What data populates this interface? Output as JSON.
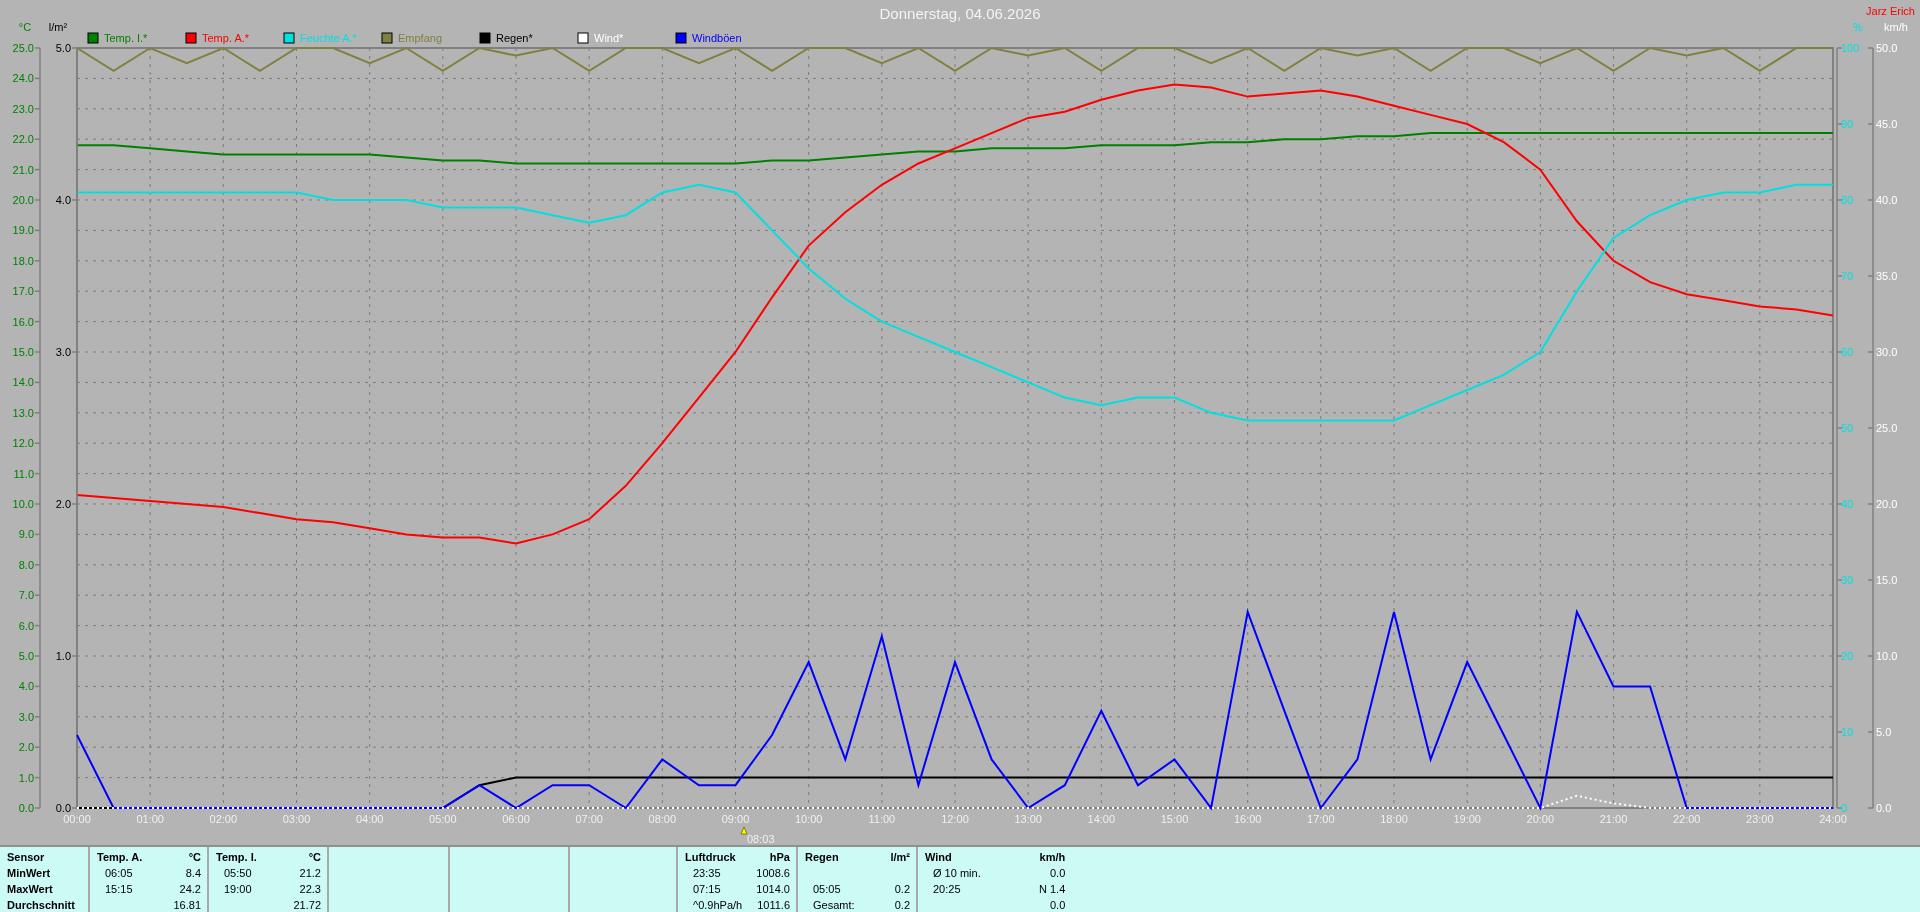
{
  "title": "Donnerstag, 04.06.2026",
  "author": "Jarz Erich",
  "plot": {
    "layers": [
      {
        "chart_data": {
          "type": "line",
          "ylabel": "°C",
          "xlim": [
            0,
            24
          ],
          "ylim": [
            0,
            25
          ],
          "grid": true,
          "legend": "top",
          "x": [
            0,
            0.5,
            1,
            1.5,
            2,
            2.5,
            3,
            3.5,
            4,
            4.5,
            5,
            5.5,
            6,
            6.5,
            7,
            7.5,
            8,
            8.5,
            9,
            9.5,
            10,
            10.5,
            11,
            11.5,
            12,
            12.5,
            13,
            13.5,
            14,
            14.5,
            15,
            15.5,
            16,
            16.5,
            17,
            17.5,
            18,
            18.5,
            19,
            19.5,
            20,
            20.5,
            21,
            21.5,
            22,
            22.5,
            23,
            23.5,
            24
          ],
          "xticks": [
            {
              "value": 0,
              "label": "00:00"
            },
            {
              "value": 1,
              "label": "01:00"
            },
            {
              "value": 2,
              "label": "02:00"
            },
            {
              "value": 3,
              "label": "03:00"
            },
            {
              "value": 4,
              "label": "04:00"
            },
            {
              "value": 5,
              "label": "05:00"
            },
            {
              "value": 6,
              "label": "06:00"
            },
            {
              "value": 7,
              "label": "07:00"
            },
            {
              "value": 8,
              "label": "08:00"
            },
            {
              "value": 9,
              "label": "09:00"
            },
            {
              "value": 10,
              "label": "10:00"
            },
            {
              "value": 11,
              "label": "11:00"
            },
            {
              "value": 12,
              "label": "12:00"
            },
            {
              "value": 13,
              "label": "13:00"
            },
            {
              "value": 14,
              "label": "14:00"
            },
            {
              "value": 15,
              "label": "15:00"
            },
            {
              "value": 16,
              "label": "16:00"
            },
            {
              "value": 17,
              "label": "17:00"
            },
            {
              "value": 18,
              "label": "18:00"
            },
            {
              "value": 19,
              "label": "19:00"
            },
            {
              "value": 20,
              "label": "20:00"
            },
            {
              "value": 21,
              "label": "21:00"
            },
            {
              "value": 22,
              "label": "22:00"
            },
            {
              "value": 23,
              "label": "23:00"
            },
            {
              "value": 24,
              "label": "24:00"
            }
          ],
          "yticks": [
            {
              "value": 0,
              "label": "0.0"
            },
            {
              "value": 1,
              "label": "1.0"
            },
            {
              "value": 2,
              "label": "2.0"
            },
            {
              "value": 3,
              "label": "3.0"
            },
            {
              "value": 4,
              "label": "4.0"
            },
            {
              "value": 5,
              "label": "5.0"
            },
            {
              "value": 6,
              "label": "6.0"
            },
            {
              "value": 7,
              "label": "7.0"
            },
            {
              "value": 8,
              "label": "8.0"
            },
            {
              "value": 9,
              "label": "9.0"
            },
            {
              "value": 10,
              "label": "10.0"
            },
            {
              "value": 11,
              "label": "11.0"
            },
            {
              "value": 12,
              "label": "12.0"
            },
            {
              "value": 13,
              "label": "13.0"
            },
            {
              "value": 14,
              "label": "14.0"
            },
            {
              "value": 15,
              "label": "15.0"
            },
            {
              "value": 16,
              "label": "16.0"
            },
            {
              "value": 17,
              "label": "17.0"
            },
            {
              "value": 18,
              "label": "18.0"
            },
            {
              "value": 19,
              "label": "19.0"
            },
            {
              "value": 20,
              "label": "20.0"
            },
            {
              "value": 21,
              "label": "21.0"
            },
            {
              "value": 22,
              "label": "22.0"
            },
            {
              "value": 23,
              "label": "23.0"
            },
            {
              "value": 24,
              "label": "24.0"
            },
            {
              "value": 25,
              "label": "25.0"
            }
          ],
          "series": [
            {
              "name": "Temp. I.*",
              "color": "#008000",
              "values": [
                21.8,
                21.8,
                21.7,
                21.6,
                21.5,
                21.5,
                21.5,
                21.5,
                21.5,
                21.4,
                21.3,
                21.3,
                21.2,
                21.2,
                21.2,
                21.2,
                21.2,
                21.2,
                21.2,
                21.3,
                21.3,
                21.4,
                21.5,
                21.6,
                21.6,
                21.7,
                21.7,
                21.7,
                21.8,
                21.8,
                21.8,
                21.9,
                21.9,
                22.0,
                22.0,
                22.1,
                22.1,
                22.2,
                22.2,
                22.2,
                22.2,
                22.2,
                22.2,
                22.2,
                22.2,
                22.2,
                22.2,
                22.2,
                22.2
              ]
            },
            {
              "name": "Temp. A.*",
              "color": "#ff0000",
              "values": [
                10.3,
                10.2,
                10.1,
                10.0,
                9.9,
                9.7,
                9.5,
                9.4,
                9.2,
                9.0,
                8.9,
                8.9,
                8.7,
                9.0,
                9.5,
                10.6,
                12.0,
                13.5,
                15.0,
                16.8,
                18.5,
                19.6,
                20.5,
                21.2,
                21.7,
                22.2,
                22.7,
                22.9,
                23.3,
                23.6,
                23.8,
                23.7,
                23.4,
                23.5,
                23.6,
                23.4,
                23.1,
                22.8,
                22.5,
                21.9,
                21.0,
                19.3,
                18.0,
                17.3,
                16.9,
                16.7,
                16.5,
                16.4,
                16.2
              ]
            }
          ],
          "annotations": [
            "08:03"
          ]
        }
      },
      {
        "chart_data": {
          "type": "line",
          "ylabel": "%",
          "ylim": [
            0,
            100
          ],
          "yticks": [
            {
              "value": 0,
              "label": "0"
            },
            {
              "value": 10,
              "label": "10"
            },
            {
              "value": 20,
              "label": "20"
            },
            {
              "value": 30,
              "label": "30"
            },
            {
              "value": 40,
              "label": "40"
            },
            {
              "value": 50,
              "label": "50"
            },
            {
              "value": 60,
              "label": "60"
            },
            {
              "value": 70,
              "label": "70"
            },
            {
              "value": 80,
              "label": "80"
            },
            {
              "value": 90,
              "label": "90"
            },
            {
              "value": 100,
              "label": "100"
            }
          ],
          "series": [
            {
              "name": "Feuchte A.*",
              "color": "#00e0e0",
              "values": [
                81,
                81,
                81,
                81,
                81,
                81,
                81,
                80,
                80,
                80,
                79,
                79,
                79,
                78,
                77,
                78,
                81,
                82,
                81,
                76,
                71,
                67,
                64,
                62,
                60,
                58,
                56,
                54,
                53,
                54,
                54,
                52,
                51,
                51,
                51,
                51,
                51,
                53,
                55,
                57,
                60,
                68,
                75,
                78,
                80,
                81,
                81,
                82,
                82
              ]
            },
            {
              "name": "Empfang",
              "color": "#808040",
              "values": [
                100,
                97,
                100,
                98,
                100,
                97,
                100,
                100,
                98,
                100,
                97,
                100,
                99,
                100,
                97,
                100,
                100,
                98,
                100,
                97,
                100,
                100,
                98,
                100,
                97,
                100,
                99,
                100,
                97,
                100,
                100,
                98,
                100,
                97,
                100,
                99,
                100,
                97,
                100,
                100,
                98,
                100,
                97,
                100,
                99,
                100,
                97,
                100,
                100
              ]
            }
          ]
        }
      },
      {
        "chart_data": {
          "type": "line",
          "ylabel": "l/m²",
          "ylim": [
            0,
            5
          ],
          "yticks": [
            {
              "value": 0,
              "label": "0.0"
            },
            {
              "value": 1,
              "label": "1.0"
            },
            {
              "value": 2,
              "label": "2.0"
            },
            {
              "value": 3,
              "label": "3.0"
            },
            {
              "value": 4,
              "label": "4.0"
            },
            {
              "value": 5,
              "label": "5.0"
            }
          ],
          "series": [
            {
              "name": "Regen*",
              "color": "#000000",
              "values": [
                0,
                0,
                0,
                0,
                0,
                0,
                0,
                0,
                0,
                0,
                0,
                0.15,
                0.2,
                0.2,
                0.2,
                0.2,
                0.2,
                0.2,
                0.2,
                0.2,
                0.2,
                0.2,
                0.2,
                0.2,
                0.2,
                0.2,
                0.2,
                0.2,
                0.2,
                0.2,
                0.2,
                0.2,
                0.2,
                0.2,
                0.2,
                0.2,
                0.2,
                0.2,
                0.2,
                0.2,
                0.2,
                0.2,
                0.2,
                0.2,
                0.2,
                0.2,
                0.2,
                0.2,
                0.2
              ]
            }
          ]
        }
      },
      {
        "chart_data": {
          "type": "line",
          "ylabel": "km/h",
          "ylim": [
            0,
            50
          ],
          "yticks": [
            {
              "value": 0,
              "label": "0.0"
            },
            {
              "value": 5,
              "label": "5.0"
            },
            {
              "value": 10,
              "label": "10.0"
            },
            {
              "value": 15,
              "label": "15.0"
            },
            {
              "value": 20,
              "label": "20.0"
            },
            {
              "value": 25,
              "label": "25.0"
            },
            {
              "value": 30,
              "label": "30.0"
            },
            {
              "value": 35,
              "label": "35.0"
            },
            {
              "value": 40,
              "label": "40.0"
            },
            {
              "value": 45,
              "label": "45.0"
            },
            {
              "value": 50,
              "label": "50.0"
            }
          ],
          "series": [
            {
              "name": "Wind*",
              "color": "#ffffff",
              "line_style": "dotted",
              "values": [
                0,
                0,
                0,
                0,
                0,
                0,
                0,
                0,
                0,
                0,
                0,
                0,
                0,
                0,
                0,
                0,
                0,
                0,
                0,
                0,
                0,
                0,
                0,
                0,
                0,
                0,
                0,
                0,
                0,
                0,
                0,
                0,
                0,
                0,
                0,
                0,
                0,
                0,
                0,
                0,
                0,
                0.8,
                0.3,
                0,
                0,
                0,
                0,
                0,
                0
              ]
            },
            {
              "name": "Windböen",
              "color": "#0000ff",
              "values": [
                4.8,
                0,
                0,
                0,
                0,
                0,
                0,
                0,
                0,
                0,
                0,
                1.5,
                0,
                1.5,
                1.5,
                0,
                3.2,
                1.5,
                1.5,
                4.8,
                9.6,
                3.2,
                11.3,
                1.5,
                9.6,
                3.2,
                0,
                1.5,
                6.4,
                1.5,
                3.2,
                0,
                12.9,
                6.4,
                0,
                3.2,
                12.9,
                3.2,
                9.6,
                4.8,
                0,
                12.9,
                8.0,
                8.0,
                0,
                0,
                0,
                0,
                0
              ]
            }
          ]
        }
      }
    ]
  },
  "stats": [
    {
      "kind": "labels",
      "header": "Sensor",
      "rows": [
        "MinWert",
        "MaxWert",
        "Durchschnitt"
      ]
    },
    {
      "kind": "values",
      "header": "Temp. A.",
      "unit": "°C",
      "rows": [
        {
          "time": "06:05",
          "value": "8.4"
        },
        {
          "time": "15:15",
          "value": "24.2"
        },
        {
          "value": "16.81"
        }
      ]
    },
    {
      "kind": "values",
      "header": "Temp. I.",
      "unit": "°C",
      "rows": [
        {
          "time": "05:50",
          "value": "21.2"
        },
        {
          "time": "19:00",
          "value": "22.3"
        },
        {
          "value": "21.72"
        }
      ]
    },
    {
      "kind": "empty"
    },
    {
      "kind": "empty"
    },
    {
      "kind": "empty"
    },
    {
      "kind": "values",
      "header": "Luftdruck",
      "unit": "hPa",
      "rows": [
        {
          "time": "23:35",
          "value": "1008.6"
        },
        {
          "time": "07:15",
          "value": "1014.0"
        },
        {
          "time": "^0.9hPa/h",
          "value": "1011.6"
        }
      ]
    },
    {
      "kind": "values",
      "header": "Regen",
      "unit": "l/m²",
      "rows": [
        {},
        {
          "time": "05:05",
          "value": "0.2"
        },
        {
          "time": "Gesamt:",
          "value": "0.2"
        }
      ]
    },
    {
      "kind": "values",
      "header": "Wind",
      "unit": "km/h",
      "rows": [
        {
          "time": "Ø 10 min.",
          "value": "0.0"
        },
        {
          "time": "20:25",
          "value": "N 1.4"
        },
        {
          "value": "0.0"
        }
      ]
    }
  ]
}
